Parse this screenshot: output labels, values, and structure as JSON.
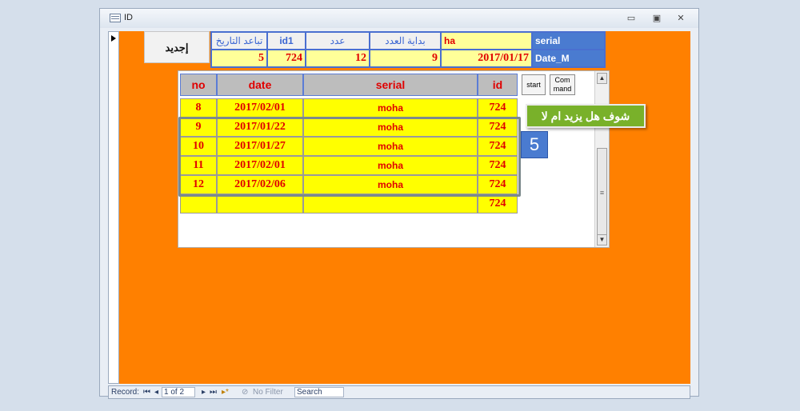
{
  "window": {
    "title": "ID",
    "controls": {
      "minimize": "▭",
      "restore": "▣",
      "close": "✕"
    }
  },
  "form": {
    "new_button": "إجديد",
    "header_labels": [
      "تباعد التاريخ",
      "id1",
      "عدد",
      "بداية العدد",
      "ha",
      "serial"
    ],
    "values": [
      "5",
      "724",
      "12",
      "9",
      "2017/01/17"
    ],
    "date_label": "Date_M"
  },
  "grid": {
    "columns": [
      "no",
      "date",
      "serial",
      "id"
    ],
    "rows": [
      {
        "no": "8",
        "date": "2017/02/01",
        "serial": "moha",
        "id": "724"
      },
      {
        "no": "9",
        "date": "2017/01/22",
        "serial": "moha",
        "id": "724"
      },
      {
        "no": "10",
        "date": "2017/01/27",
        "serial": "moha",
        "id": "724"
      },
      {
        "no": "11",
        "date": "2017/02/01",
        "serial": "moha",
        "id": "724"
      },
      {
        "no": "12",
        "date": "2017/02/06",
        "serial": "moha",
        "id": "724"
      },
      {
        "no": "",
        "date": "",
        "serial": "",
        "id": "724"
      }
    ]
  },
  "buttons": {
    "start": "start",
    "command": "Com mand"
  },
  "annotation": {
    "callout": "شوف هل يزيد ام لا",
    "badge": "5"
  },
  "navigation": {
    "record_label": "Record:",
    "first": "⏮",
    "prev": "◂",
    "position": "1 of 2",
    "next": "▸",
    "last": "⏭",
    "new": "▸*",
    "filter": "No Filter",
    "search": "Search"
  },
  "colors": {
    "form_background": "#ff8000",
    "cell_yellow": "#ffff00",
    "text_red": "#e00000",
    "header_blue": "#3b66d3",
    "callout_green": "#79b12a",
    "badge_blue": "#4a7bd0"
  }
}
